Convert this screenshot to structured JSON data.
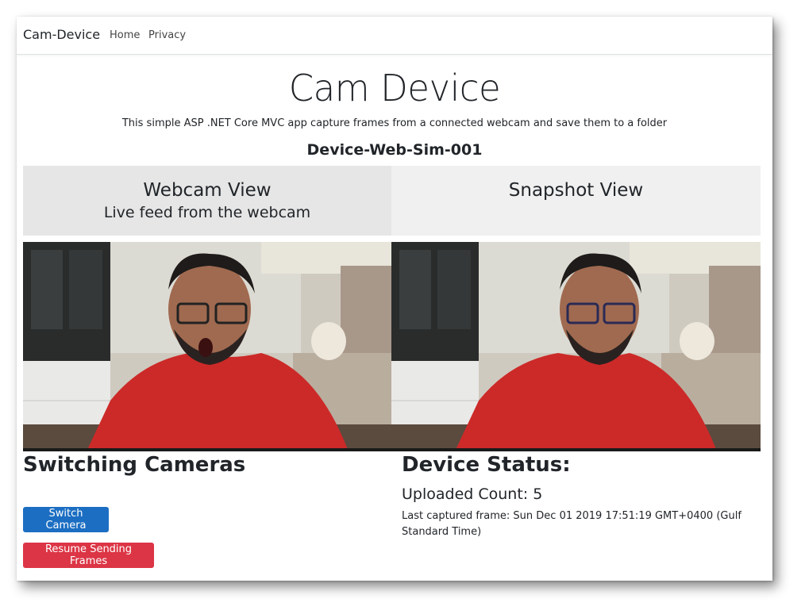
{
  "navbar": {
    "brand": "Cam-Device",
    "links": [
      "Home",
      "Privacy"
    ]
  },
  "header": {
    "title": "Cam Device",
    "subtitle": "This simple ASP .NET Core MVC app capture frames from a connected webcam and save them to a folder",
    "device_id": "Device-Web-Sim-001"
  },
  "webcam_panel": {
    "title": "Webcam View",
    "subtitle": "Live feed from the webcam"
  },
  "snapshot_panel": {
    "title": "Snapshot View"
  },
  "switching": {
    "title": "Switching Cameras",
    "switch_label": "Switch Camera",
    "resume_label": "Resume Sending Frames"
  },
  "status": {
    "title": "Device Status:",
    "uploaded": "Uploaded Count: 5",
    "last_frame": "Last captured frame: Sun Dec 01 2019 17:51:19 GMT+0400 (Gulf Standard Time)"
  },
  "colors": {
    "primary": "#1b6ec2",
    "danger": "#dc3545",
    "panel_gray": "#e6e6e6",
    "panel_light": "#f0f0f0"
  }
}
